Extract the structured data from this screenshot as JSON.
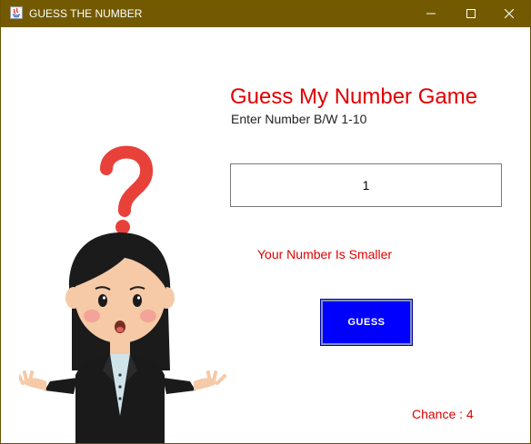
{
  "window": {
    "title": "GUESS THE NUMBER",
    "titlebar_color": "#735a00"
  },
  "main": {
    "heading": "Guess My Number Game",
    "subheading": "Enter Number B/W 1-10",
    "input_value": "1",
    "feedback": "Your Number Is Smaller",
    "guess_button_label": "GUESS",
    "chance_text": "Chance : 4"
  },
  "colors": {
    "accent_red": "#e00000",
    "button_blue": "#0000ff"
  },
  "icons": [
    "java-app-icon",
    "minimize-icon",
    "maximize-icon",
    "close-icon",
    "question-mark-icon",
    "confused-girl-illustration"
  ]
}
